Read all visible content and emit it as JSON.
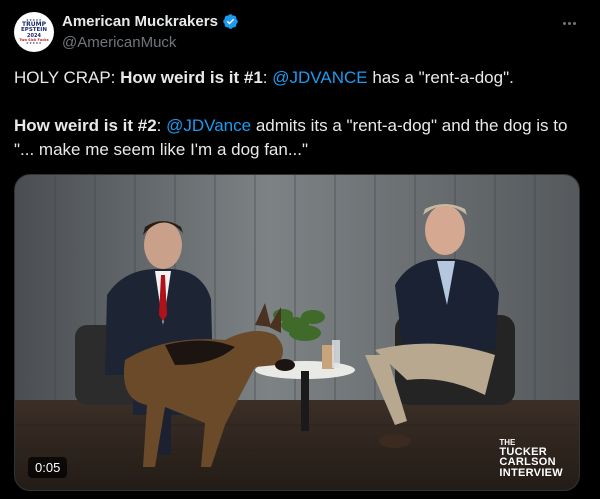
{
  "author": {
    "display_name": "American Muckrakers",
    "handle": "@AmericanMuck",
    "verified": true,
    "avatar_badge": {
      "line1": "TRUMP",
      "line2": "EPSTEIN",
      "line3": "2024",
      "line4": "Two Sick Fucks"
    }
  },
  "post": {
    "line1": {
      "lead": "HOLY CRAP:  ",
      "bold": "How weird is it #1",
      "sep": ":  ",
      "mention": "@JDVANCE",
      "rest": " has a \"rent-a-dog\"."
    },
    "line2": {
      "bold": "How weird is it #2",
      "sep": ":  ",
      "mention": "@JDVance",
      "rest": " admits its a \"rent-a-dog\" and the dog is to \"... make me seem like I'm a dog fan...\""
    }
  },
  "media": {
    "duration": "0:05",
    "watermark_top": "THE",
    "watermark_lines": [
      "TUCKER",
      "CARLSON",
      "INTERVIEW"
    ]
  },
  "icons": {
    "verified": "verified-badge-icon",
    "more": "more-options-icon"
  },
  "colors": {
    "background": "#000000",
    "text": "#e7e9ea",
    "secondary": "#71767b",
    "link": "#1d9bf0",
    "verified": "#1d9bf0"
  }
}
